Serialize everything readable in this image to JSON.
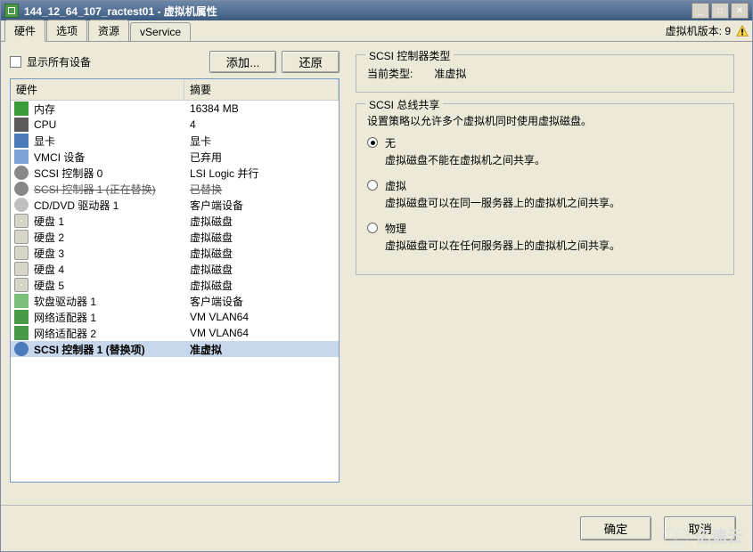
{
  "title": "144_12_64_107_ractest01 - 虚拟机属性",
  "window_controls": {
    "min": "_",
    "max": "□",
    "close": "✕"
  },
  "tabs": [
    "硬件",
    "选项",
    "资源",
    "vService"
  ],
  "active_tab": 0,
  "version_label": "虚拟机版本: 9",
  "show_all_label": "显示所有设备",
  "buttons": {
    "add": "添加...",
    "restore": "还原",
    "ok": "确定",
    "cancel": "取消"
  },
  "hw_headers": {
    "name": "硬件",
    "summary": "摘要"
  },
  "hardware": [
    {
      "icon": "ic-mem",
      "icon_name": "memory-icon",
      "name": "内存",
      "summary": "16384 MB"
    },
    {
      "icon": "ic-cpu",
      "icon_name": "cpu-icon",
      "name": "CPU",
      "summary": "4"
    },
    {
      "icon": "ic-disp",
      "icon_name": "display-icon",
      "name": "显卡",
      "summary": "显卡"
    },
    {
      "icon": "ic-vmci",
      "icon_name": "vmci-icon",
      "name": "VMCI 设备",
      "summary": "已弃用"
    },
    {
      "icon": "ic-scsi",
      "icon_name": "scsi-icon",
      "name": "SCSI 控制器 0",
      "summary": "LSI Logic 并行"
    },
    {
      "icon": "ic-scsi",
      "icon_name": "scsi-icon",
      "name": "SCSI 控制器 1 (正在替换)",
      "summary": "已替换",
      "strike": true
    },
    {
      "icon": "ic-cd",
      "icon_name": "cd-icon",
      "name": "CD/DVD 驱动器 1",
      "summary": "客户端设备"
    },
    {
      "icon": "ic-hdd",
      "icon_name": "disk-icon",
      "name": "硬盘 1",
      "summary": "虚拟磁盘"
    },
    {
      "icon": "ic-hdd",
      "icon_name": "disk-icon",
      "name": "硬盘 2",
      "summary": "虚拟磁盘"
    },
    {
      "icon": "ic-hdd",
      "icon_name": "disk-icon",
      "name": "硬盘 3",
      "summary": "虚拟磁盘"
    },
    {
      "icon": "ic-hdd",
      "icon_name": "disk-icon",
      "name": "硬盘 4",
      "summary": "虚拟磁盘"
    },
    {
      "icon": "ic-hdd",
      "icon_name": "disk-icon",
      "name": "硬盘 5",
      "summary": "虚拟磁盘"
    },
    {
      "icon": "ic-floppy",
      "icon_name": "floppy-icon",
      "name": "软盘驱动器 1",
      "summary": "客户端设备"
    },
    {
      "icon": "ic-nic",
      "icon_name": "nic-icon",
      "name": "网络适配器 1",
      "summary": "VM VLAN64"
    },
    {
      "icon": "ic-nic",
      "icon_name": "nic-icon",
      "name": "网络适配器 2",
      "summary": "VM VLAN64"
    },
    {
      "icon": "ic-scsi-sel",
      "icon_name": "scsi-icon",
      "name": "SCSI 控制器 1 (替换项)",
      "summary": "准虚拟",
      "selected": true
    }
  ],
  "controller_type": {
    "legend": "SCSI 控制器类型",
    "label": "当前类型:",
    "value": "准虚拟"
  },
  "bus_sharing": {
    "legend": "SCSI 总线共享",
    "desc": "设置策略以允许多个虚拟机同时使用虚拟磁盘。",
    "options": [
      {
        "label": "无",
        "desc": "虚拟磁盘不能在虚拟机之间共享。",
        "checked": true
      },
      {
        "label": "虚拟",
        "desc": "虚拟磁盘可以在同一服务器上的虚拟机之间共享。",
        "checked": false
      },
      {
        "label": "物理",
        "desc": "虚拟磁盘可以在任何服务器上的虚拟机之间共享。",
        "checked": false
      }
    ]
  },
  "watermark": "亿速云"
}
